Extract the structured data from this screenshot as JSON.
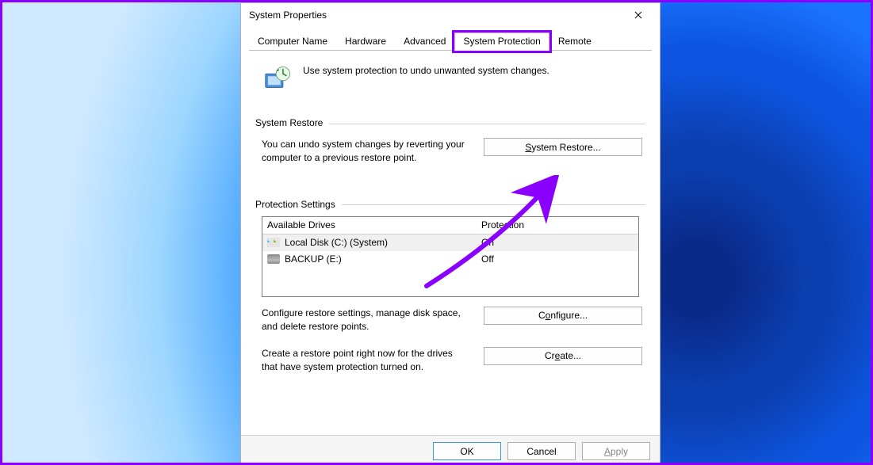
{
  "window": {
    "title": "System Properties"
  },
  "tabs": {
    "computer_name": "Computer Name",
    "hardware": "Hardware",
    "advanced": "Advanced",
    "system_protection": "System Protection",
    "remote": "Remote"
  },
  "intro": "Use system protection to undo unwanted system changes.",
  "restore": {
    "group": "System Restore",
    "desc": "You can undo system changes by reverting your computer to a previous restore point.",
    "button_pre": "S",
    "button_rest": "ystem Restore..."
  },
  "protection": {
    "group": "Protection Settings",
    "col_drives": "Available Drives",
    "col_protection": "Protection",
    "drives": [
      {
        "name": "Local Disk (C:) (System)",
        "status": "On",
        "system": true
      },
      {
        "name": "BACKUP (E:)",
        "status": "Off",
        "system": false
      }
    ],
    "configure_desc": "Configure restore settings, manage disk space, and delete restore points.",
    "configure_btn_pre": "C",
    "configure_btn_mid": "onfigure...",
    "create_desc": "Create a restore point right now for the drives that have system protection turned on.",
    "create_btn_pre": "Cr",
    "create_btn_u": "e",
    "create_btn_post": "ate..."
  },
  "footer": {
    "ok": "OK",
    "cancel": "Cancel",
    "apply_u": "A",
    "apply_rest": "pply"
  }
}
